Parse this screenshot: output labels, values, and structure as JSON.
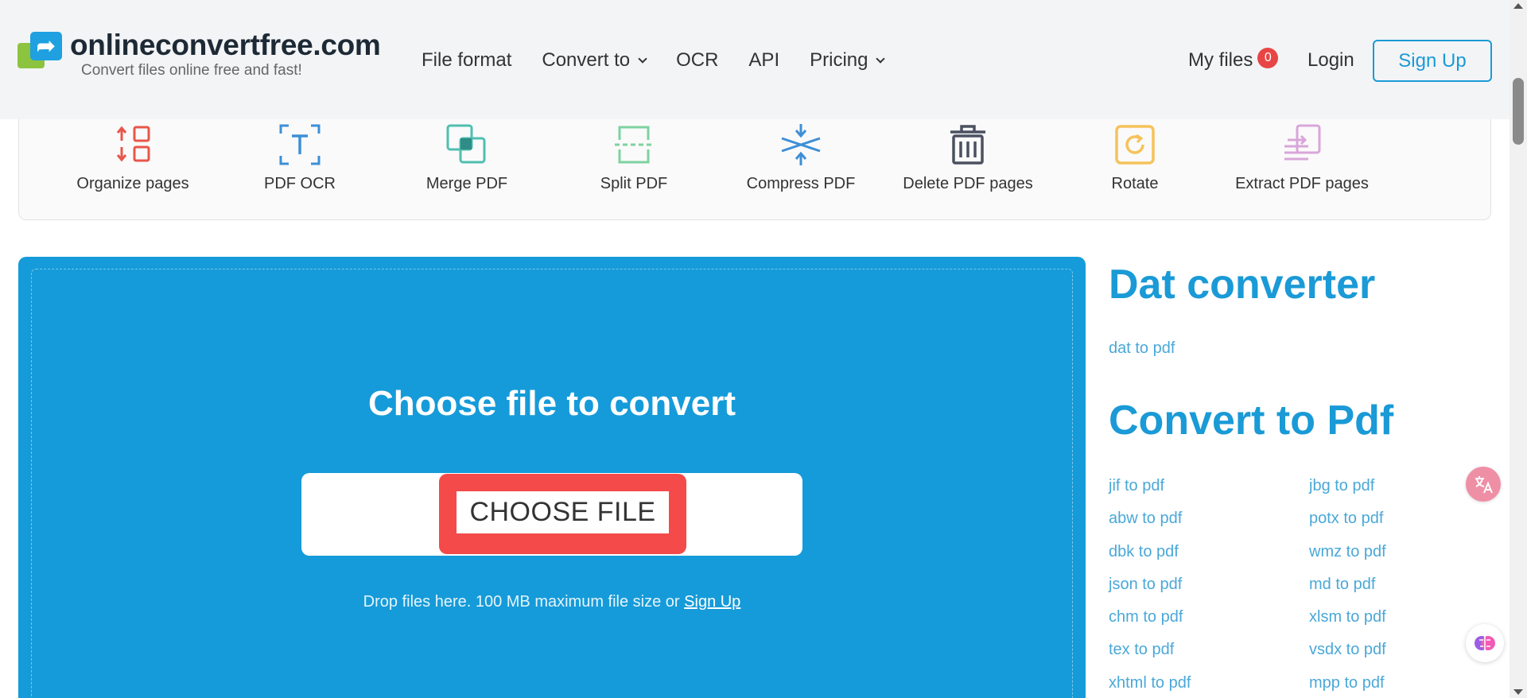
{
  "header": {
    "logo_name": "onlineconvertfree.com",
    "logo_tagline": "Convert files online free and fast!",
    "nav": [
      {
        "label": "File format",
        "dropdown": false
      },
      {
        "label": "Convert to",
        "dropdown": true
      },
      {
        "label": "OCR",
        "dropdown": false
      },
      {
        "label": "API",
        "dropdown": false
      },
      {
        "label": "Pricing",
        "dropdown": true
      }
    ],
    "my_files_label": "My files",
    "my_files_count": "0",
    "login_label": "Login",
    "signup_label": "Sign Up"
  },
  "tools": [
    {
      "label": "Organize pages",
      "icon": "organize-pages-icon",
      "color": "#e8574a"
    },
    {
      "label": "PDF OCR",
      "icon": "pdf-ocr-icon",
      "color": "#3d8fd6"
    },
    {
      "label": "Merge PDF",
      "icon": "merge-pdf-icon",
      "color": "#4fbfb0"
    },
    {
      "label": "Split PDF",
      "icon": "split-pdf-icon",
      "color": "#7dd3a0"
    },
    {
      "label": "Compress PDF",
      "icon": "compress-pdf-icon",
      "color": "#3d8fd6"
    },
    {
      "label": "Delete PDF pages",
      "icon": "trash-icon",
      "color": "#4b5160"
    },
    {
      "label": "Rotate",
      "icon": "rotate-icon",
      "color": "#f6c25b"
    },
    {
      "label": "Extract PDF pages",
      "icon": "extract-pdf-pages-icon",
      "color": "#d9a6d9"
    }
  ],
  "upload": {
    "title": "Choose file to convert",
    "button_label": "CHOOSE FILE",
    "note": "Drop files here. 100 MB maximum file size or",
    "note_link": "Sign Up"
  },
  "sidebar": {
    "heading1": "Dat converter",
    "link1": "dat to pdf",
    "heading2": "Convert to Pdf",
    "links_left": [
      "jif to pdf",
      "abw to pdf",
      "dbk to pdf",
      "json to pdf",
      "chm to pdf",
      "tex to pdf",
      "xhtml to pdf"
    ],
    "links_right": [
      "jbg to pdf",
      "potx to pdf",
      "wmz to pdf",
      "md to pdf",
      "xlsm to pdf",
      "vsdx to pdf",
      "mpp to pdf"
    ]
  },
  "colors": {
    "accent": "#1a9ad6",
    "upload_bg": "#159bd9",
    "choose_button": "#f44a4a",
    "header_bg": "#f3f4f6"
  },
  "floating": {
    "translate_icon": "translate-icon",
    "brain_icon": "brain-icon"
  }
}
